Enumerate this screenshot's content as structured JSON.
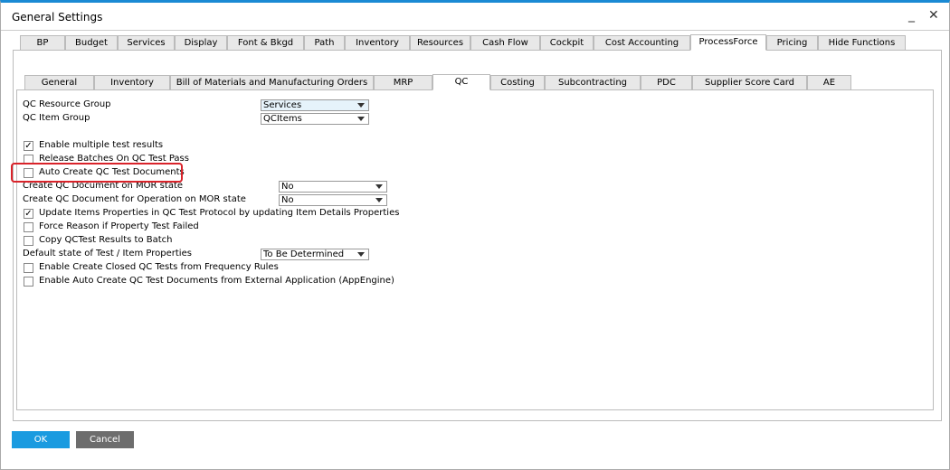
{
  "window": {
    "title": "General Settings",
    "minimize": "_",
    "close": "✕"
  },
  "top_tabs": [
    "BP",
    "Budget",
    "Services",
    "Display",
    "Font & Bkgd",
    "Path",
    "Inventory",
    "Resources",
    "Cash Flow",
    "Cockpit",
    "Cost Accounting",
    "ProcessForce",
    "Pricing",
    "Hide Functions"
  ],
  "top_selected": "ProcessForce",
  "sub_tabs": [
    "General",
    "Inventory",
    "Bill of Materials and Manufacturing Orders",
    "MRP",
    "QC",
    "Costing",
    "Subcontracting",
    "PDC",
    "Supplier Score Card",
    "AE"
  ],
  "sub_selected": "QC",
  "fields": {
    "resource_group": {
      "label": "QC Resource Group",
      "value": "Services"
    },
    "item_group": {
      "label": "QC Item Group",
      "value": "QCItems"
    },
    "mor_state": {
      "label": "Create QC Document on MOR state",
      "value": "No"
    },
    "op_mor_state": {
      "label": "Create QC Document for Operation on MOR state",
      "value": "No"
    },
    "default_state": {
      "label": "Default state of Test / Item Properties",
      "value": "To Be Determined"
    }
  },
  "checkboxes": {
    "multiple": {
      "label": "Enable multiple test results",
      "checked": true
    },
    "release": {
      "label": "Release Batches On QC Test Pass",
      "checked": false
    },
    "auto_create": {
      "label": "Auto Create QC Test Documents",
      "checked": false
    },
    "update_items": {
      "label": "Update Items Properties in QC Test Protocol by updating Item Details Properties",
      "checked": true
    },
    "force_reason": {
      "label": "Force Reason if Property Test Failed",
      "checked": false
    },
    "copy_results": {
      "label": "Copy QCTest Results to Batch",
      "checked": false
    },
    "closed_tests": {
      "label": "Enable Create Closed QC Tests from Frequency Rules",
      "checked": false
    },
    "external": {
      "label": "Enable Auto Create QC Test Documents from External Application (AppEngine)",
      "checked": false
    }
  },
  "buttons": {
    "ok": "OK",
    "cancel": "Cancel"
  },
  "colors": {
    "accent": "#1a9be0",
    "cancel": "#6d6d6d",
    "highlight": "#d9232a"
  }
}
